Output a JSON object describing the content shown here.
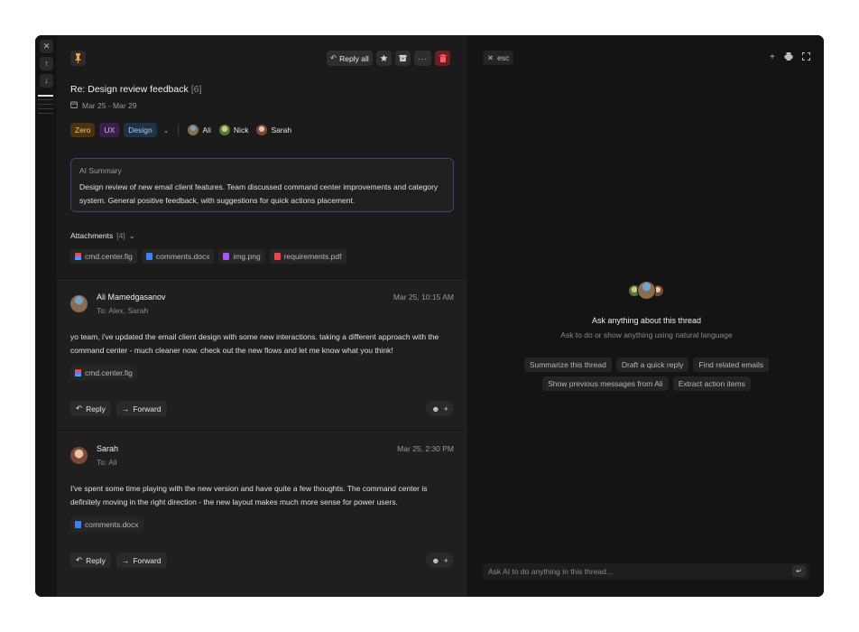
{
  "colors": {
    "accent_border": "#4a3d78",
    "danger": "#6b1f24",
    "window_bg": "#141414"
  },
  "rail": {
    "close_icon": "close-icon",
    "up_icon": "arrow-up-icon",
    "down_icon": "arrow-down-icon"
  },
  "toolbar": {
    "reply_all_label": "Reply all"
  },
  "thread": {
    "subject": "Re: Design review feedback",
    "count": "[6]",
    "date_range": "Mar 25 - Mar 29",
    "tags": [
      "Zero",
      "UX",
      "Design"
    ],
    "participants": [
      "Ali",
      "Nick",
      "Sarah"
    ]
  },
  "summary": {
    "label": "AI Summary",
    "text": "Design review of new email client features. Team discussed command center improvements and category system. General positive feedback, with suggestions for quick actions placement."
  },
  "attachments": {
    "title": "Attachments",
    "count": "[4]",
    "files": [
      "cmd.center.fig",
      "comments.docx",
      "img.png",
      "requirements.pdf"
    ]
  },
  "messages": [
    {
      "sender": "Ali Mamedgasanov",
      "to": "To: Alex, Sarah",
      "time": "Mar 25, 10:15 AM",
      "body": "yo team, i've updated the email client design with some new interactions. taking a different approach with the command center - much cleaner now. check out the new flows and let me know what you think!",
      "file": "cmd.center.fig",
      "reply_label": "Reply",
      "forward_label": "Forward"
    },
    {
      "sender": "Sarah",
      "to": "To: Ali",
      "time": "Mar 25, 2:30 PM",
      "body": "I've spent some time playing with the new version and have quite a few thoughts. The command center is definitely moving in the right direction - the new layout makes much more sense for power users.",
      "file": "comments.docx",
      "reply_label": "Reply",
      "forward_label": "Forward"
    }
  ],
  "ai": {
    "esc_label": "esc",
    "title": "Ask anything about this thread",
    "subtitle": "Ask to do or show anything using natural language",
    "suggestions_row1": [
      "Summarize this thread",
      "Draft a quick reply",
      "Find related emails"
    ],
    "suggestions_row2": [
      "Show previous messages from Ali",
      "Extract action items"
    ],
    "input_placeholder": "Ask AI to do anything in this thread..."
  }
}
